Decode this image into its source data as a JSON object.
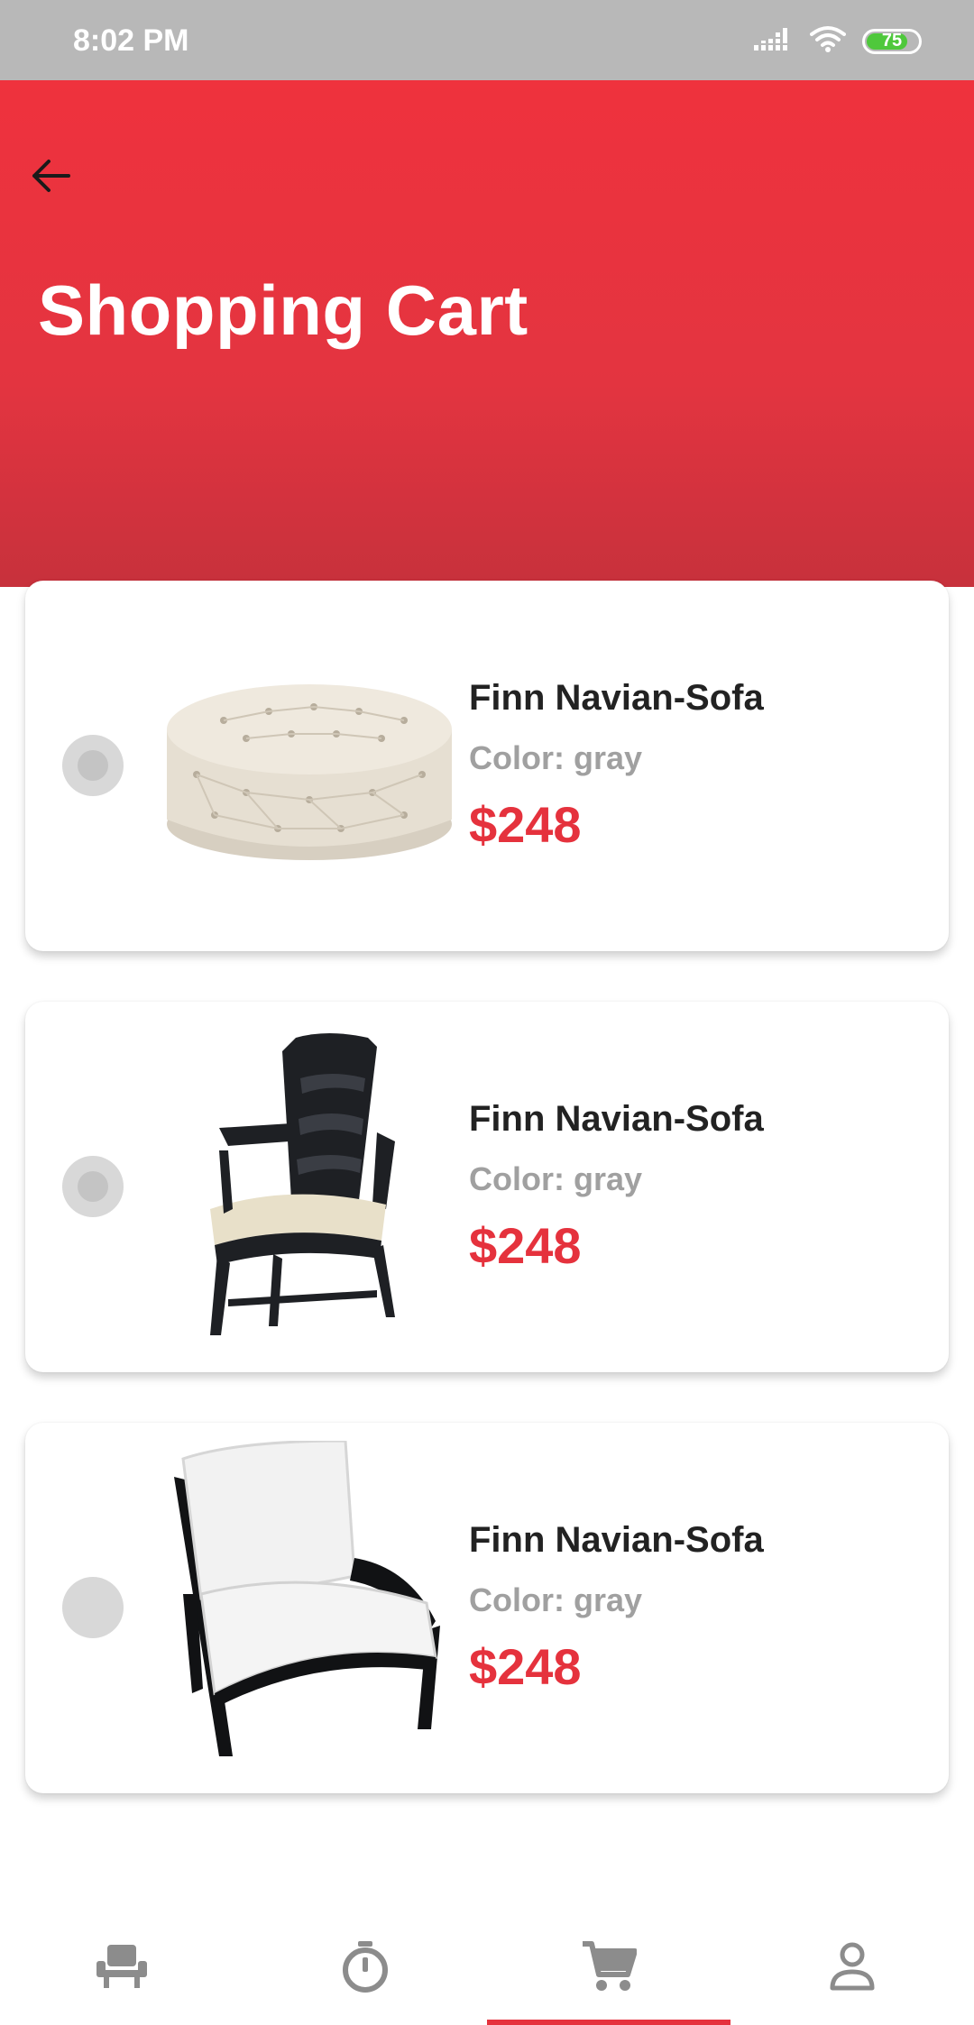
{
  "status_bar": {
    "time": "8:02 PM",
    "battery_level": "75",
    "battery_fraction": 0.75
  },
  "header": {
    "title": "Shopping Cart",
    "back_icon": "arrow-left-icon"
  },
  "cart": {
    "items": [
      {
        "name": "Finn Navian-Sofa",
        "color": "Color: gray",
        "price": "$248",
        "selected": true,
        "image": "tufted-ottoman"
      },
      {
        "name": "Finn Navian-Sofa",
        "color": "Color: gray",
        "price": "$248",
        "selected": true,
        "image": "carved-armchair"
      },
      {
        "name": "Finn Navian-Sofa",
        "color": "Color: gray",
        "price": "$248",
        "selected": false,
        "image": "cushioned-lounge-chair"
      }
    ]
  },
  "bottom_nav": {
    "items": [
      {
        "icon": "chair-icon",
        "active": false
      },
      {
        "icon": "timer-icon",
        "active": false
      },
      {
        "icon": "cart-icon",
        "active": true
      },
      {
        "icon": "person-icon",
        "active": false
      }
    ]
  },
  "colors": {
    "accent": "#e5323d",
    "header_top": "#ef323d",
    "header_bottom": "#c7313c",
    "status_bar": "#b8b8b8",
    "nav_icon": "#8c8c8c"
  }
}
